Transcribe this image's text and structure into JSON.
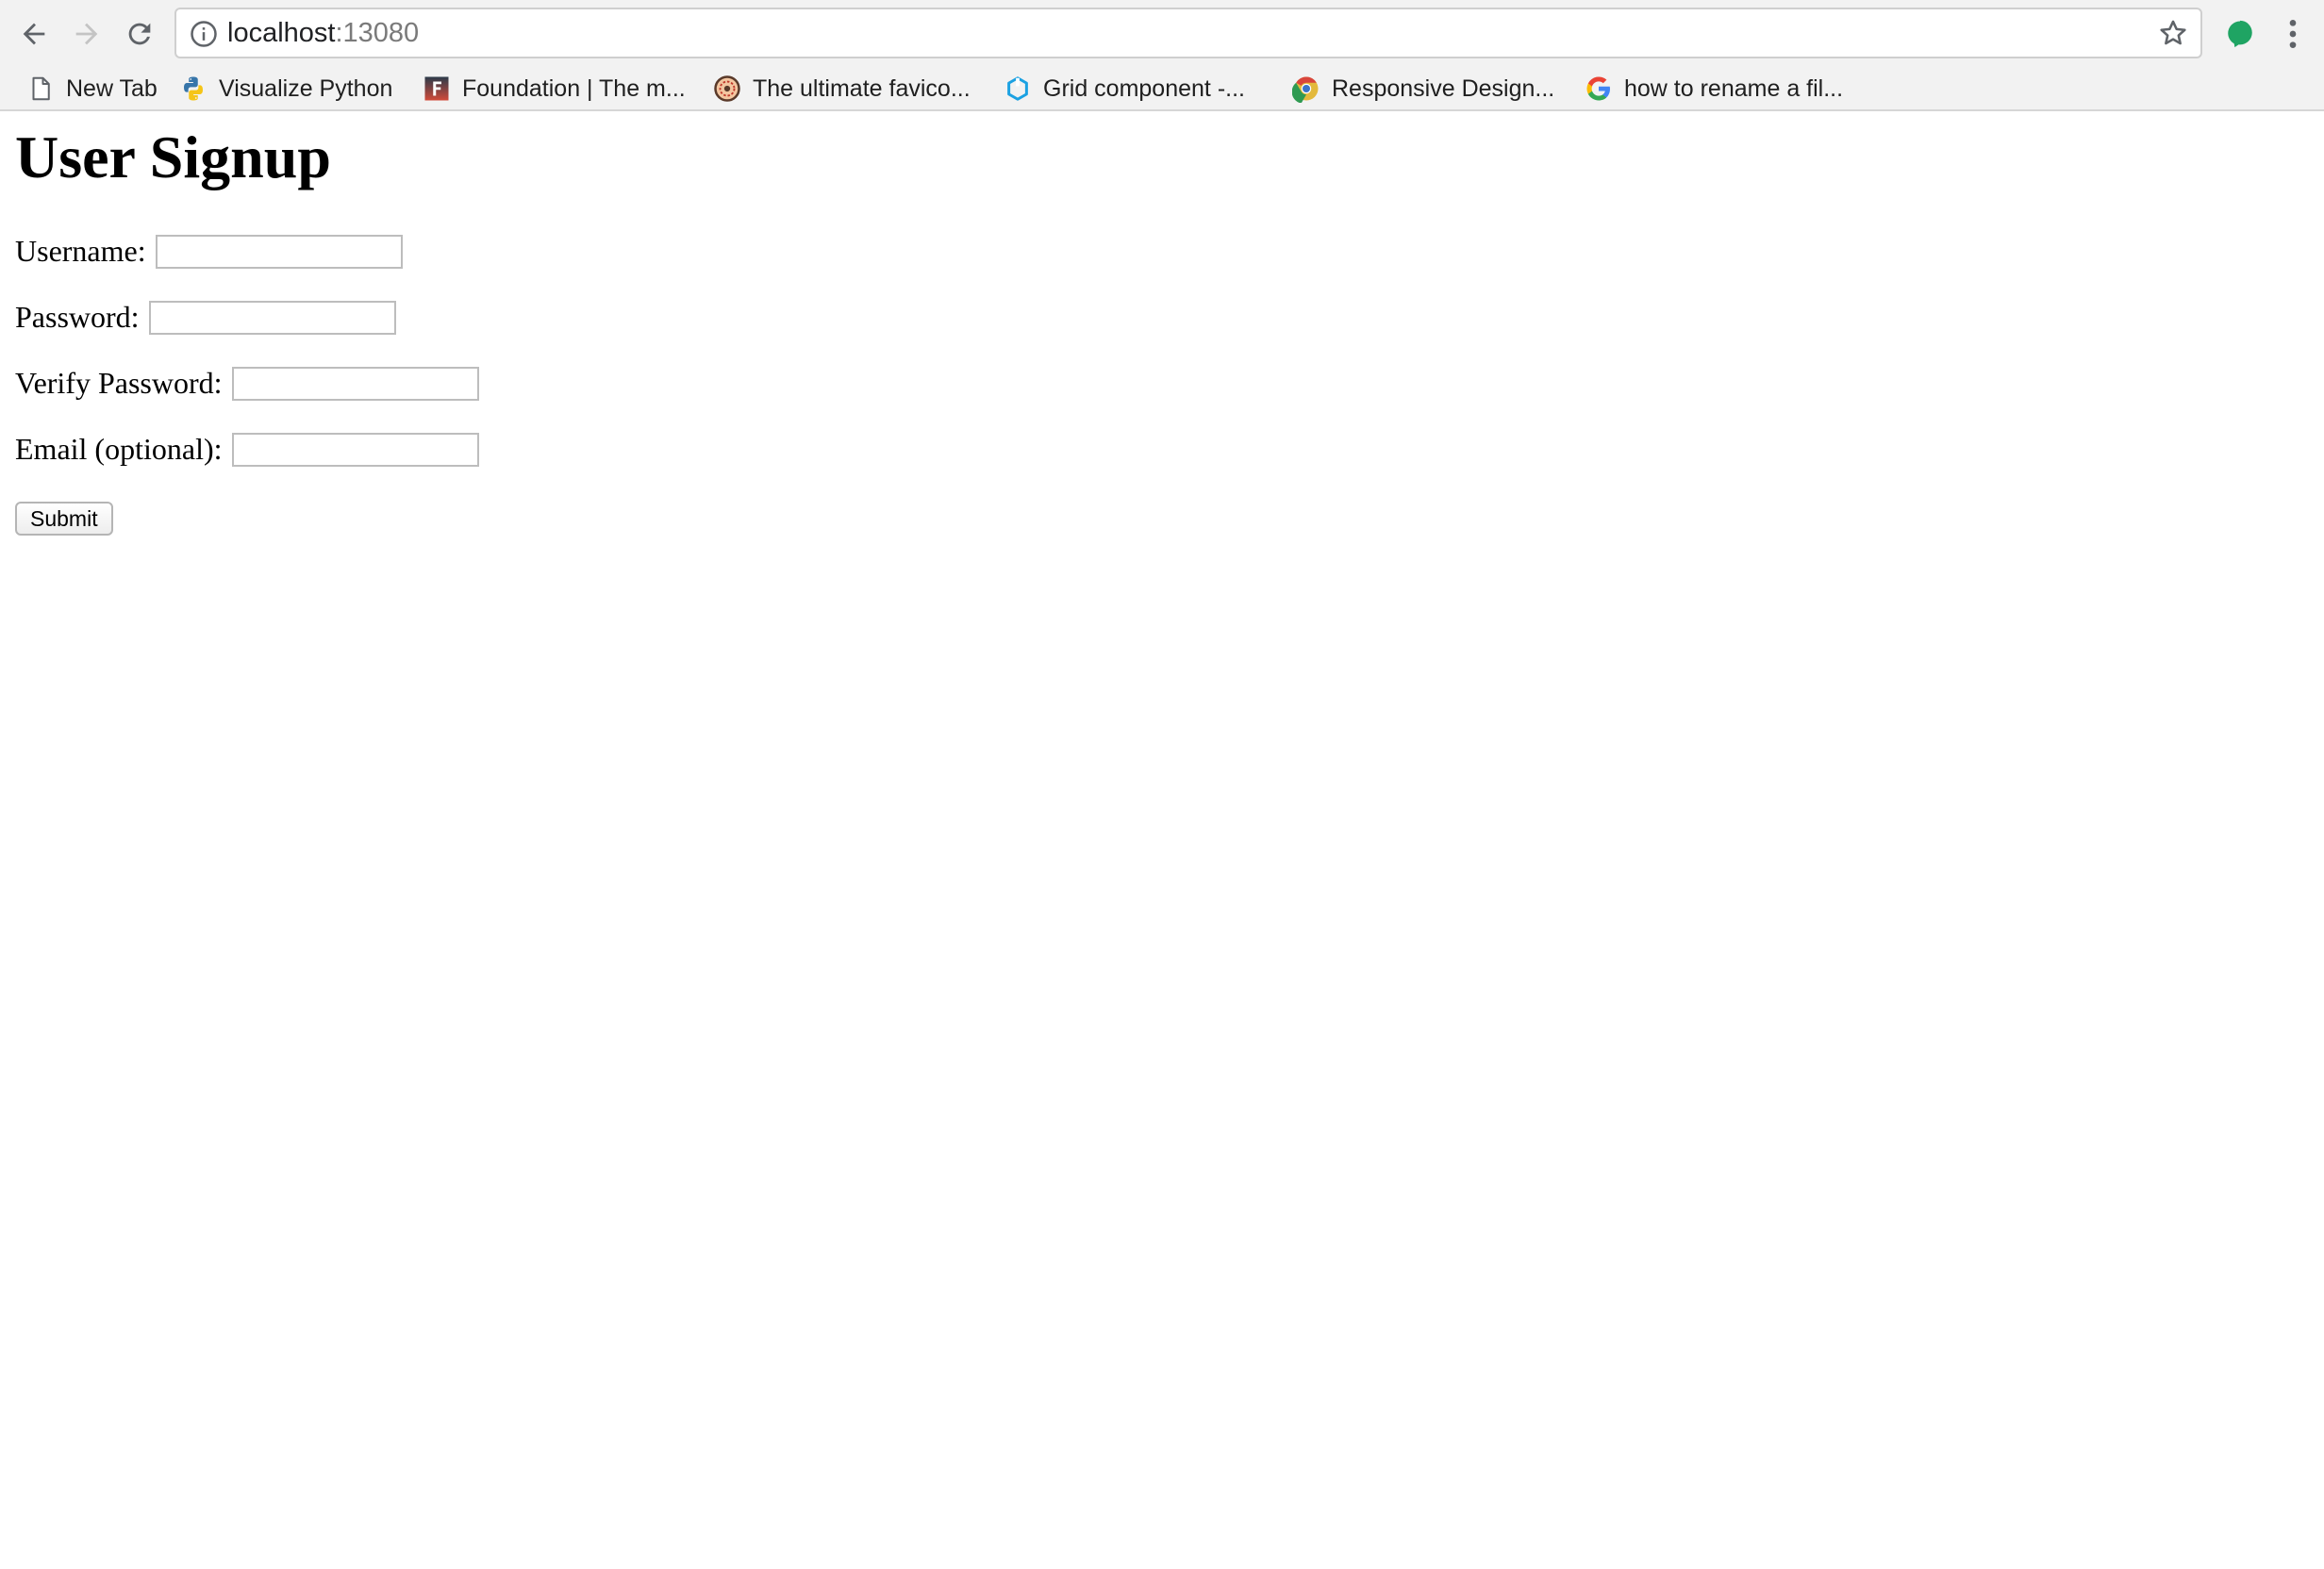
{
  "browser": {
    "url_host": "localhost",
    "url_port": ":13080",
    "bookmarks": [
      {
        "label": "New Tab",
        "icon": "page-icon"
      },
      {
        "label": "Visualize Python",
        "icon": "python-icon"
      },
      {
        "label": "Foundation | The m...",
        "icon": "foundation-icon"
      },
      {
        "label": "The ultimate favico...",
        "icon": "favicon-generator-icon"
      },
      {
        "label": "Grid component -...",
        "icon": "grid-component-icon"
      },
      {
        "label": "Responsive Design...",
        "icon": "chrome-icon"
      },
      {
        "label": "how to rename a fil...",
        "icon": "google-icon"
      }
    ],
    "extension_color": "#1fa463"
  },
  "page": {
    "title": "User Signup",
    "fields": [
      {
        "label": "Username:",
        "value": ""
      },
      {
        "label": "Password:",
        "value": ""
      },
      {
        "label": "Verify Password:",
        "value": ""
      },
      {
        "label": "Email (optional):",
        "value": ""
      }
    ],
    "submit_label": "Submit"
  }
}
